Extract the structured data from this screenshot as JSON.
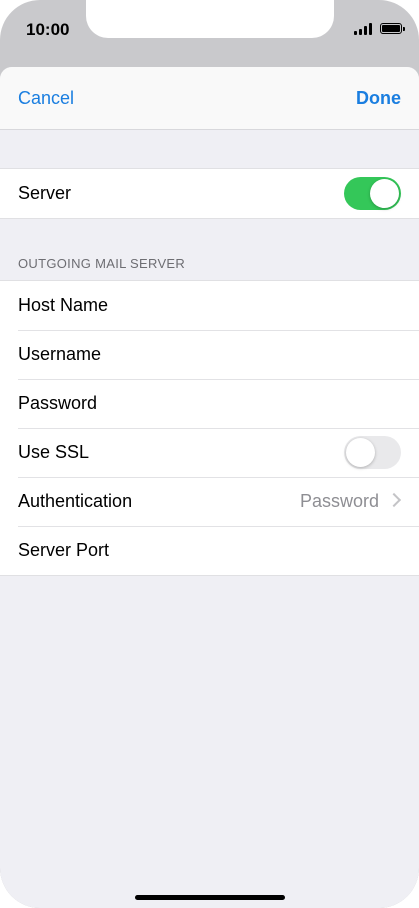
{
  "status_bar": {
    "time": "10:00",
    "signal_icon": "cellular-signal-icon",
    "battery_icon": "battery-icon"
  },
  "nav": {
    "cancel_label": "Cancel",
    "done_label": "Done",
    "accent_color": "#1a7ee0"
  },
  "server_group": {
    "server_label": "Server",
    "server_enabled": true,
    "toggle_on_color": "#34c759"
  },
  "outgoing": {
    "section_title": "OUTGOING MAIL SERVER",
    "host_name_label": "Host Name",
    "username_label": "Username",
    "password_label": "Password",
    "use_ssl_label": "Use SSL",
    "use_ssl_enabled": false,
    "authentication_label": "Authentication",
    "authentication_value": "Password",
    "server_port_label": "Server Port"
  }
}
